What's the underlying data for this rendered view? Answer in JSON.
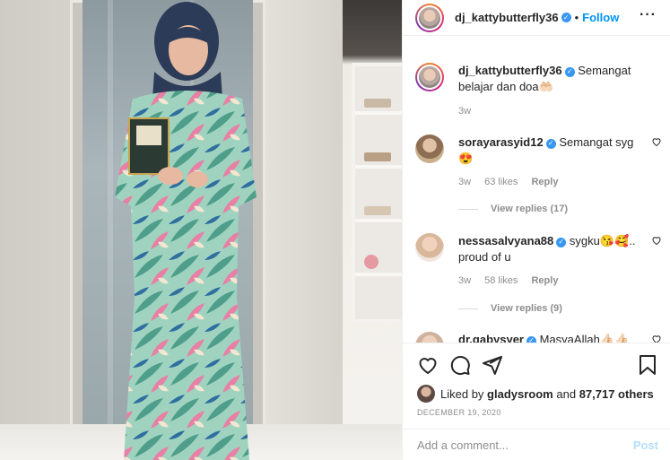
{
  "post": {
    "author": {
      "username": "dj_kattybutterfly36",
      "verified_icon": "verified-badge-icon",
      "follow_label": "Follow"
    },
    "more_icon": "more-options-icon",
    "caption": {
      "username": "dj_kattybutterfly36",
      "text": "Semangat belajar dan doa🤲🏻",
      "time": "3w"
    },
    "comments": [
      {
        "username": "sorayarasyid12",
        "text": "Semangat syg😍",
        "time": "3w",
        "likes": "63 likes",
        "reply_label": "Reply",
        "view_replies": "View replies (17)"
      },
      {
        "username": "nessasalvyana88",
        "text": "sygku😘🥰.. proud of u",
        "time": "3w",
        "likes": "58 likes",
        "reply_label": "Reply",
        "view_replies": "View replies (9)"
      },
      {
        "username": "dr.gabysyer",
        "text": "MasyaAllah👍🏻👍🏻",
        "time": "",
        "likes": "",
        "reply_label": "",
        "view_replies": ""
      }
    ],
    "actions": {
      "like_icon": "heart-icon",
      "comment_icon": "comment-icon",
      "share_icon": "share-icon",
      "save_icon": "bookmark-icon"
    },
    "likes": {
      "prefix": "Liked by",
      "user": "gladysroom",
      "conj": "and",
      "others": "87,717 others"
    },
    "date": "DECEMBER 19, 2020",
    "comment_box": {
      "placeholder": "Add a comment...",
      "post_label": "Post"
    },
    "colors": {
      "link_blue": "#0095f6",
      "verified_blue": "#3897f0",
      "muted": "#8e8e8e"
    }
  }
}
